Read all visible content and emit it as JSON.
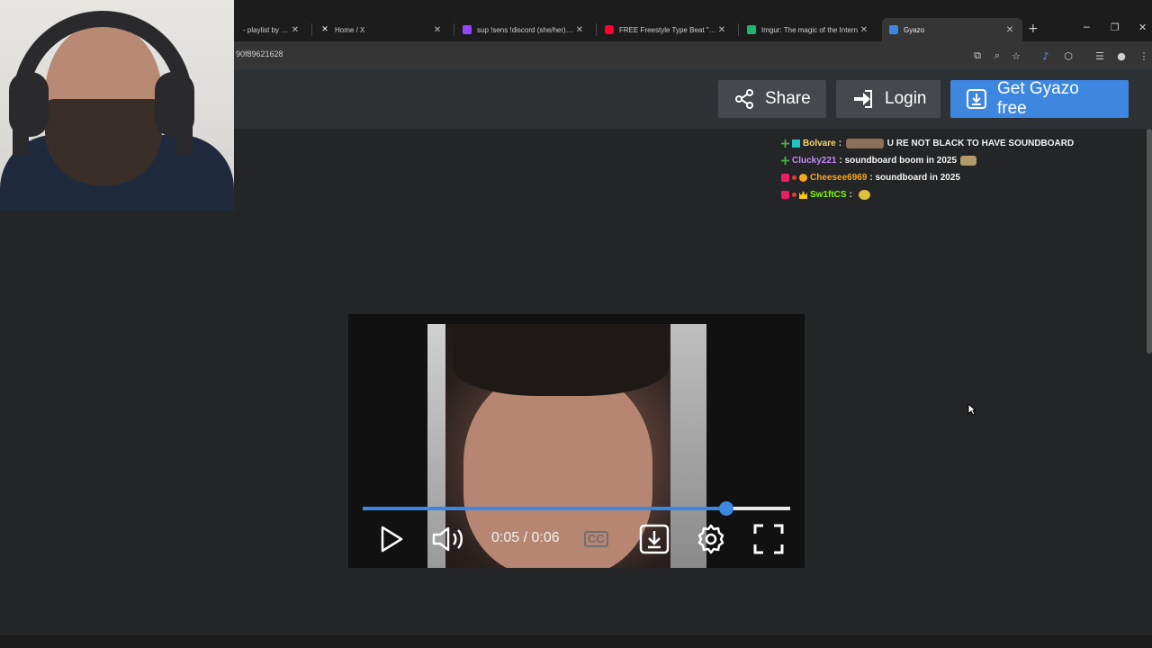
{
  "browser": {
    "tabs": [
      {
        "label": "- playlist by Gani",
        "icon": "music-icon",
        "active": false
      },
      {
        "label": "Home / X",
        "icon": "x-logo-icon",
        "active": false
      },
      {
        "label": "sup !sens !discord (she/her) - Tw",
        "icon": "twitch-icon",
        "active": false
      },
      {
        "label": "FREE Freestyle Type Beat \"DAM",
        "icon": "youtube-icon",
        "active": false
      },
      {
        "label": "Imgur: The magic of the Intern",
        "icon": "imgur-icon",
        "active": false
      },
      {
        "label": "Gyazo",
        "icon": "gyazo-icon",
        "active": true
      }
    ],
    "url": "90f89621628"
  },
  "gyazo_header": {
    "share_label": "Share",
    "login_label": "Login",
    "get_label": "Get Gyazo free"
  },
  "chat": [
    {
      "user": "Bolvare",
      "user_color": "#f5d76e",
      "message": "U RE NOT BLACK TO HAVE SOUNDBOARD",
      "has_emote_before": true
    },
    {
      "user": "Clucky221",
      "user_color": "#c58af9",
      "message": "soundboard boom in 2025",
      "has_emote_after": true
    },
    {
      "user": "Cheesee6969",
      "user_color": "#f5a623",
      "message": "soundboard in 2025"
    },
    {
      "user": "Sw1ftCS",
      "user_color": "#7cfc00",
      "message": "",
      "has_emote_after": true
    }
  ],
  "player": {
    "time_display": "0:05 / 0:06",
    "cc_label": "CC",
    "progress": 0.85
  },
  "colors": {
    "accent": "#3d87e0",
    "header_bg": "#2e3134",
    "page_bg": "#242526"
  }
}
